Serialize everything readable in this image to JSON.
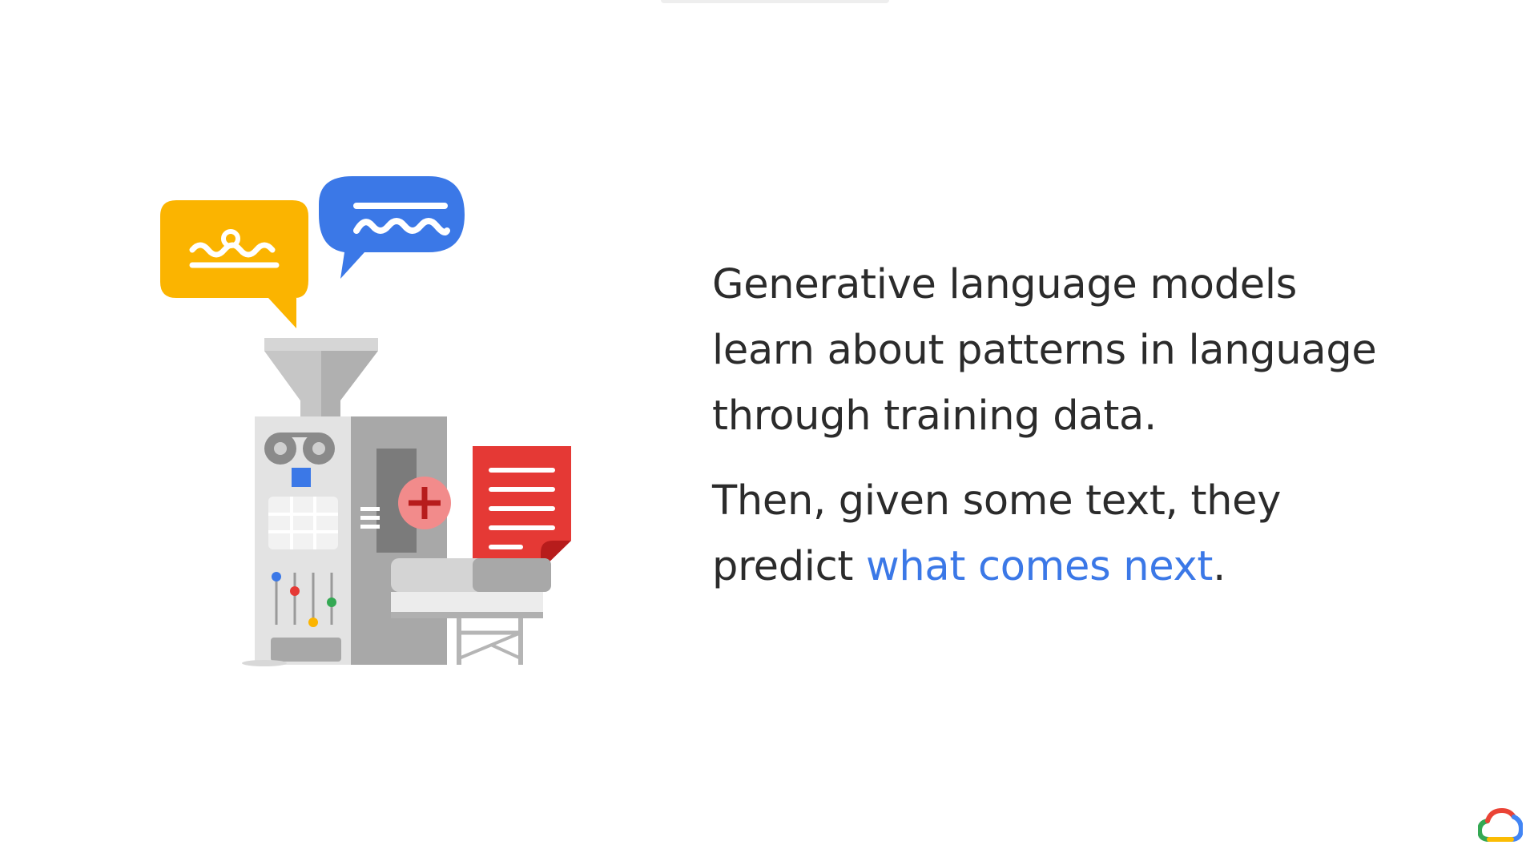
{
  "slide": {
    "paragraph1": {
      "line1": "Generative language models",
      "line2": "learn about patterns in language",
      "line3": "through training data."
    },
    "paragraph2": {
      "line1": "Then, given some text, they",
      "line2_prefix": "predict ",
      "line2_highlight": "what comes next",
      "line2_suffix": "."
    }
  },
  "icons": [
    "speech-bubble-icon",
    "funnel-icon",
    "machine-icon",
    "plus-icon",
    "document-icon",
    "conveyor-icon",
    "google-cloud-logo"
  ],
  "colors": {
    "text": "#2b2b2b",
    "highlight": "#3b78e7",
    "yellow": "#fbb400",
    "blue": "#3b78e7",
    "red": "#e53935",
    "pink": "#f28b8b",
    "green": "#34a853"
  }
}
